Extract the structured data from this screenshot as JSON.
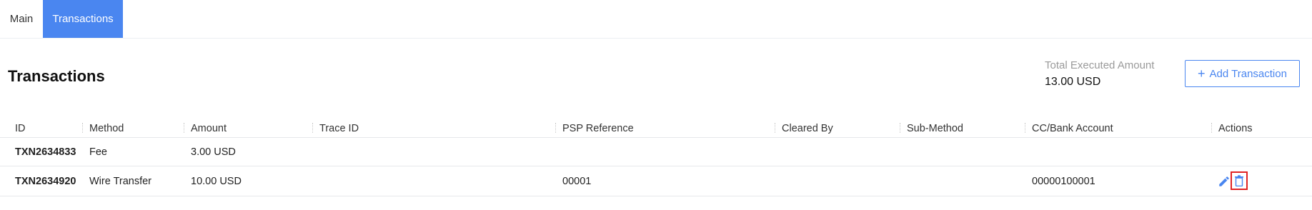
{
  "tabs": [
    {
      "label": "Main",
      "active": false
    },
    {
      "label": "Transactions",
      "active": true
    }
  ],
  "page": {
    "title": "Transactions",
    "total_label": "Total Executed Amount",
    "total_value": "13.00 USD",
    "add_button_label": "Add Transaction",
    "add_button_icon": "plus-icon"
  },
  "table": {
    "headers": [
      "ID",
      "Method",
      "Amount",
      "Trace ID",
      "PSP Reference",
      "Cleared By",
      "Sub-Method",
      "CC/Bank Account",
      "Actions"
    ],
    "rows": [
      {
        "id": "TXN2634833",
        "method": "Fee",
        "amount": "3.00 USD",
        "trace_id": "",
        "psp_reference": "",
        "cleared_by": "",
        "sub_method": "",
        "account": ""
      },
      {
        "id": "TXN2634920",
        "method": "Wire Transfer",
        "amount": "10.00 USD",
        "trace_id": "",
        "psp_reference": "00001",
        "cleared_by": "",
        "sub_method": "",
        "account": "00000100001",
        "actions": [
          "pencil-icon",
          "trash-icon"
        ]
      }
    ]
  },
  "colors": {
    "accent": "#4a86f0",
    "highlight": "#e02424"
  }
}
